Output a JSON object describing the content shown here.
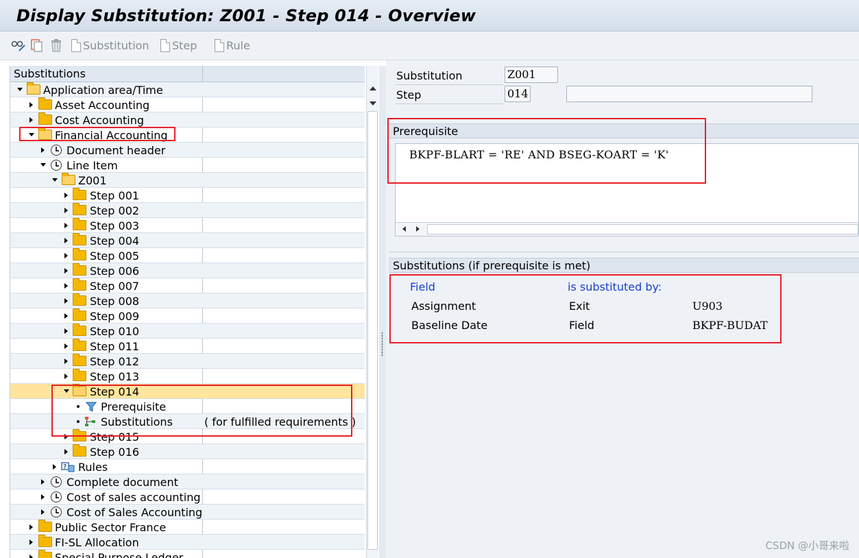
{
  "window": {
    "title": "Display Substitution: Z001 - Step 014 - Overview"
  },
  "toolbar": {
    "substitution_label": "Substitution",
    "step_label": "Step",
    "rule_label": "Rule"
  },
  "tree": {
    "header": "Substitutions",
    "rows": [
      {
        "label": "Application area/Time",
        "right": ""
      },
      {
        "label": "Asset Accounting",
        "right": ""
      },
      {
        "label": "Cost Accounting",
        "right": ""
      },
      {
        "label": "Financial Accounting",
        "right": ""
      },
      {
        "label": "Document header",
        "right": ""
      },
      {
        "label": "Line Item",
        "right": ""
      },
      {
        "label": "Z001",
        "right": ""
      },
      {
        "label": "Step 001",
        "right": ""
      },
      {
        "label": "Step 002",
        "right": ""
      },
      {
        "label": "Step 003",
        "right": ""
      },
      {
        "label": "Step 004",
        "right": ""
      },
      {
        "label": "Step 005",
        "right": ""
      },
      {
        "label": "Step 006",
        "right": ""
      },
      {
        "label": "Step 007",
        "right": ""
      },
      {
        "label": "Step 008",
        "right": ""
      },
      {
        "label": "Step 009",
        "right": ""
      },
      {
        "label": "Step 010",
        "right": ""
      },
      {
        "label": "Step 011",
        "right": ""
      },
      {
        "label": "Step 012",
        "right": ""
      },
      {
        "label": "Step 013",
        "right": ""
      },
      {
        "label": "Step 014",
        "right": ""
      },
      {
        "label": "Prerequisite",
        "right": ""
      },
      {
        "label": "Substitutions",
        "right": "( for fulfilled requirements )"
      },
      {
        "label": "Step 015",
        "right": ""
      },
      {
        "label": "Step 016",
        "right": ""
      },
      {
        "label": "Rules",
        "right": ""
      },
      {
        "label": "Complete document",
        "right": ""
      },
      {
        "label": "Cost of sales accounting",
        "right": ""
      },
      {
        "label": "Cost of Sales Accounting (N",
        "right": ""
      },
      {
        "label": "Public Sector France",
        "right": ""
      },
      {
        "label": "FI-SL Allocation",
        "right": ""
      },
      {
        "label": "Special Purpose Ledger",
        "right": ""
      }
    ]
  },
  "detail": {
    "substitution_label": "Substitution",
    "substitution_value": "Z001",
    "step_label": "Step",
    "step_value": "014",
    "step_description": "",
    "prerequisite_title": "Prerequisite",
    "prerequisite_code": "BKPF-BLART = 'RE' AND BSEG-KOART = 'K'",
    "substitutions_title": "Substitutions (if prerequisite is met)",
    "col_field": "Field",
    "col_substituted_by": "is substituted by:",
    "rows": [
      {
        "field": "Assignment",
        "type": "Exit",
        "value": "U903"
      },
      {
        "field": "Baseline Date",
        "type": "Field",
        "value": "BKPF-BUDAT"
      }
    ]
  },
  "watermark": "CSDN @小哥来啦",
  "colors": {
    "highlight": "#e8202a",
    "selected_row": "#ffe59e",
    "link_blue": "#1a3fd0"
  }
}
